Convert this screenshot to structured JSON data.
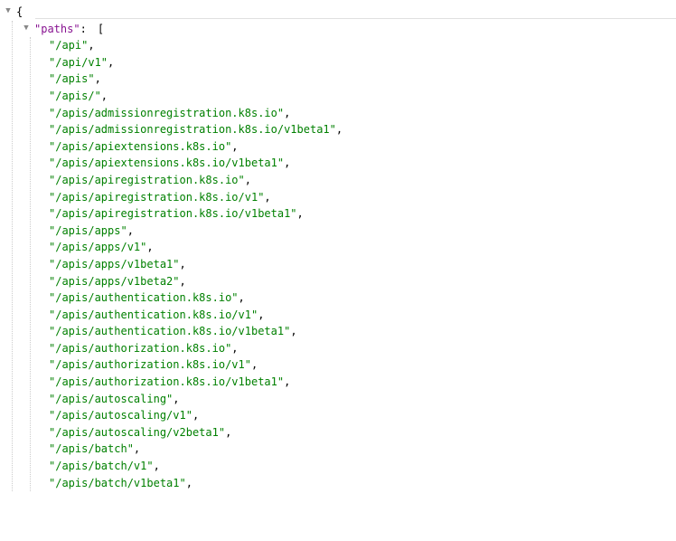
{
  "root": {
    "open_brace": "{",
    "paths_key": "\"paths\"",
    "colon": ":",
    "open_bracket": "[",
    "items": [
      "\"/api\"",
      "\"/api/v1\"",
      "\"/apis\"",
      "\"/apis/\"",
      "\"/apis/admissionregistration.k8s.io\"",
      "\"/apis/admissionregistration.k8s.io/v1beta1\"",
      "\"/apis/apiextensions.k8s.io\"",
      "\"/apis/apiextensions.k8s.io/v1beta1\"",
      "\"/apis/apiregistration.k8s.io\"",
      "\"/apis/apiregistration.k8s.io/v1\"",
      "\"/apis/apiregistration.k8s.io/v1beta1\"",
      "\"/apis/apps\"",
      "\"/apis/apps/v1\"",
      "\"/apis/apps/v1beta1\"",
      "\"/apis/apps/v1beta2\"",
      "\"/apis/authentication.k8s.io\"",
      "\"/apis/authentication.k8s.io/v1\"",
      "\"/apis/authentication.k8s.io/v1beta1\"",
      "\"/apis/authorization.k8s.io\"",
      "\"/apis/authorization.k8s.io/v1\"",
      "\"/apis/authorization.k8s.io/v1beta1\"",
      "\"/apis/autoscaling\"",
      "\"/apis/autoscaling/v1\"",
      "\"/apis/autoscaling/v2beta1\"",
      "\"/apis/batch\"",
      "\"/apis/batch/v1\"",
      "\"/apis/batch/v1beta1\""
    ],
    "comma": ","
  }
}
